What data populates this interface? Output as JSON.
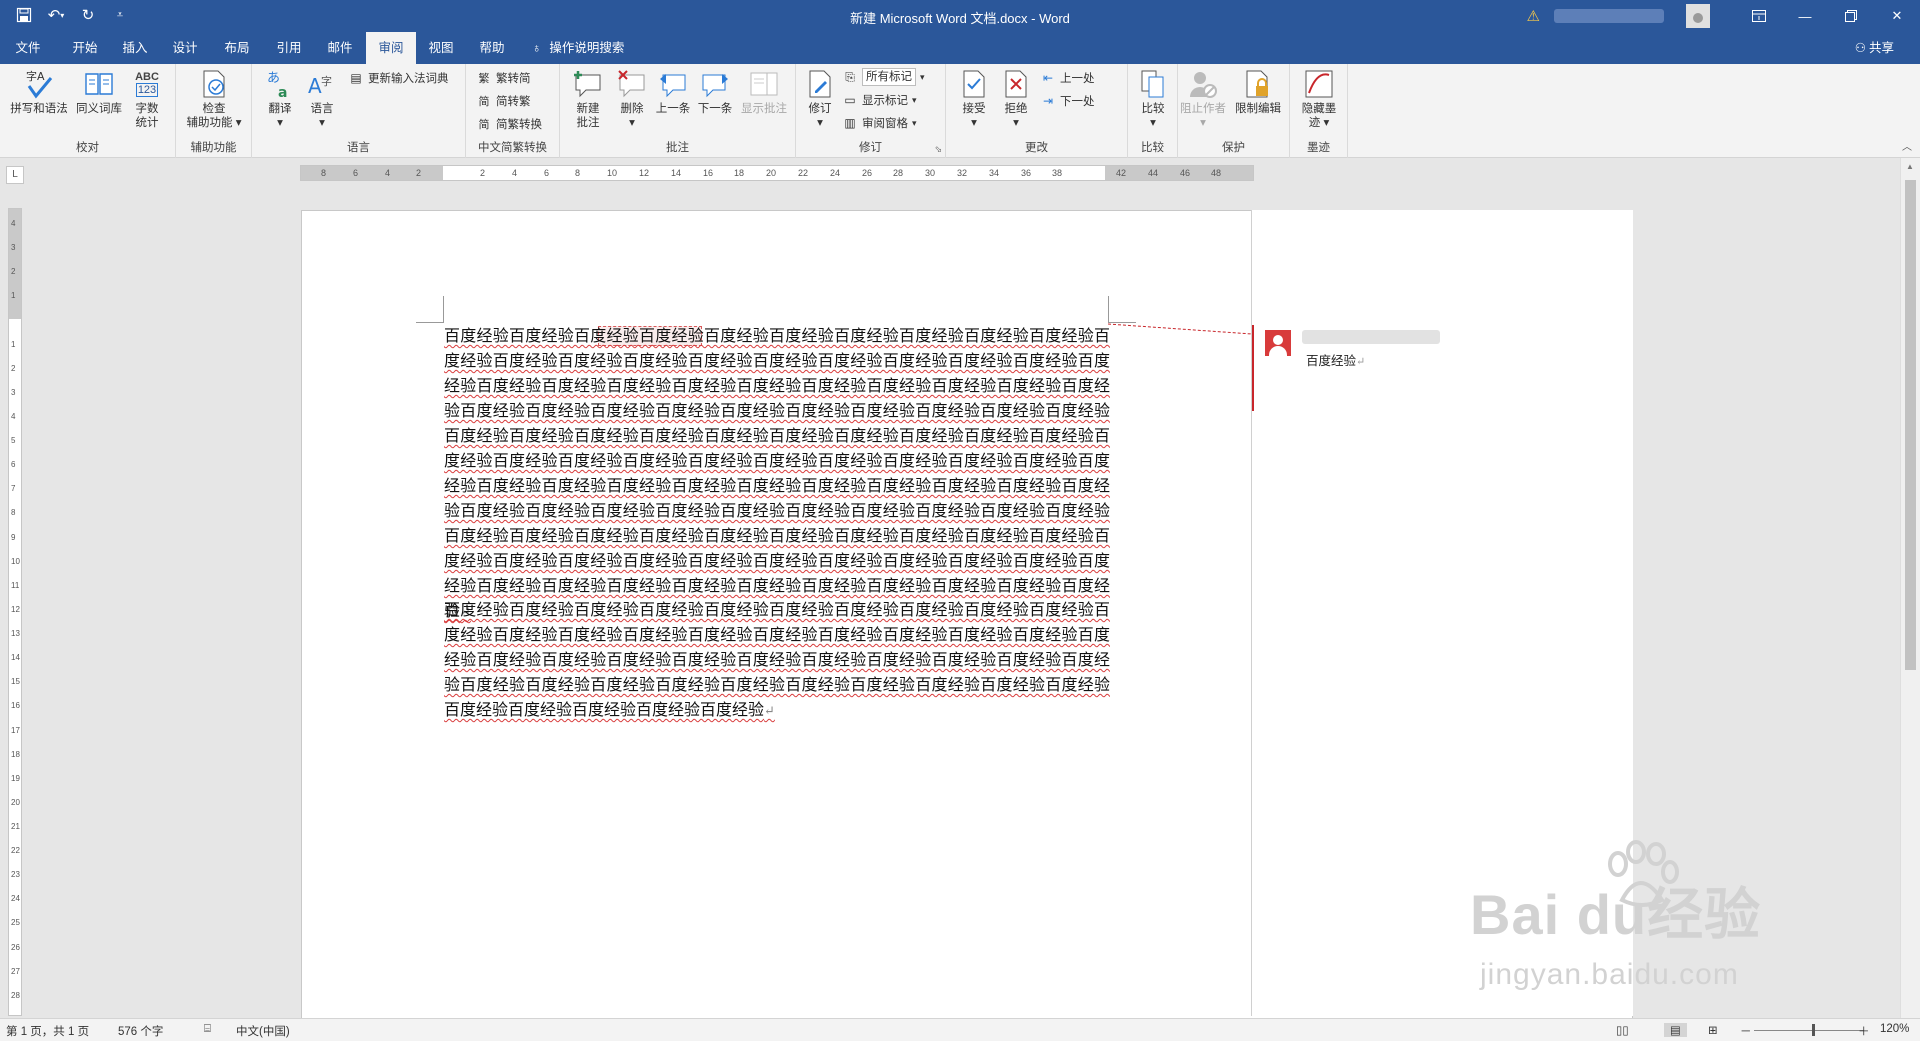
{
  "window": {
    "title": "新建 Microsoft Word 文档.docx  -  Word",
    "controls": [
      "restore-ribbon",
      "minimize",
      "maximize",
      "close"
    ]
  },
  "quick_access": {
    "icons": [
      "save-icon",
      "undo-icon",
      "redo-icon",
      "customize-icon"
    ]
  },
  "tabs": [
    {
      "label": "文件"
    },
    {
      "label": "开始"
    },
    {
      "label": "插入"
    },
    {
      "label": "设计"
    },
    {
      "label": "布局"
    },
    {
      "label": "引用"
    },
    {
      "label": "邮件"
    },
    {
      "label": "审阅",
      "active": true
    },
    {
      "label": "视图"
    },
    {
      "label": "帮助"
    }
  ],
  "tell_me": "操作说明搜索",
  "share": "共享",
  "ribbon": {
    "proofing": {
      "label": "校对",
      "spelling": "拼写和语法",
      "thesaurus": "同义词库",
      "wordcount_l1": "字数",
      "wordcount_l2": "统计",
      "wordcount_icon_text": "ABC",
      "wordcount_icon_num": "123",
      "spelling_icon_text": "字A"
    },
    "accessibility": {
      "label": "辅助功能",
      "check_l1": "检查",
      "check_l2": "辅助功能"
    },
    "language": {
      "label": "语言",
      "translate": "翻译",
      "language": "语言",
      "update_ime": "更新输入法词典"
    },
    "chinese_conversion": {
      "label": "中文简繁转换",
      "to_simplified": "繁转简",
      "to_traditional": "简转繁",
      "convert": "简繁转换"
    },
    "comments": {
      "label": "批注",
      "new_l1": "新建",
      "new_l2": "批注",
      "delete": "删除",
      "previous": "上一条",
      "next": "下一条",
      "show": "显示批注"
    },
    "tracking": {
      "label": "修订",
      "track": "修订",
      "markup_value": "所有标记",
      "show_markup": "显示标记",
      "reviewing_pane": "审阅窗格"
    },
    "changes": {
      "label": "更改",
      "accept": "接受",
      "reject": "拒绝",
      "previous": "上一处",
      "next": "下一处"
    },
    "compare": {
      "label": "比较",
      "compare": "比较"
    },
    "protect": {
      "label": "保护",
      "block_authors": "阻止作者",
      "restrict": "限制编辑"
    },
    "ink": {
      "label": "墨迹",
      "hide_l1": "隐藏墨",
      "hide_l2": "迹"
    }
  },
  "ruler": {
    "corner": "L",
    "h_numbers": [
      "8",
      "6",
      "4",
      "2",
      "",
      "2",
      "4",
      "6",
      "8",
      "10",
      "12",
      "14",
      "16",
      "18",
      "20",
      "22",
      "24",
      "26",
      "28",
      "30",
      "32",
      "34",
      "36",
      "38",
      "",
      "42",
      "44",
      "46",
      "48"
    ],
    "v_numbers": [
      "4",
      "3",
      "2",
      "1",
      "",
      "1",
      "2",
      "3",
      "4",
      "5",
      "6",
      "7",
      "8",
      "9",
      "10",
      "11",
      "12",
      "13",
      "14",
      "15",
      "16",
      "17",
      "18",
      "19",
      "20",
      "21",
      "22",
      "23",
      "24",
      "25",
      "26",
      "27",
      "28"
    ]
  },
  "document": {
    "paragraph1": "百度经验百度经验百度经验百度经验百度经验百度经验百度经验百度经验百度经验百度经验百度经验百度经验百度经验百度经验百度经验百度经验百度经验百度经验百度经验百度经验百度经验百度经验百度经验百度经验百度经验百度经验百度经验百度经验百度经验百度经验百度经验百度经验百度经验百度经验百度经验百度经验百度经验百度经验百度经验百度经验百度经验百度经验百度经验百度经验百度经验百度经验百度经验百度经验百度经验百度经验百度经验百度经验百度经验百度经验百度经验百度经验百度经验百度经验百度经验百度经验百度经验百度经验百度经验百度经验百度经验百度经验百度经验百度经验百度经验百度经验百度经验百度经验百度经验百度经验百度经验百度经验百度经验百度经验百度经验百度经验百度经验百度经验百度经验百度经验百度经验百度经验百度经验百度经验百度经验百度经验百度经验百度经验百度经验百度经验百度经验百度经验百度经验百度经验百度经验百度经验百度经验百度经验百度经验百度经验百度经验百度经验百度经验百度经验百度经验百度经验百度经验百度经验百度经验",
    "paragraph2": "百度经验百度经验百度经验百度经验百度经验百度经验百度经验百度经验百度经验百度经验百度经验百度经验百度经验百度经验百度经验百度经验百度经验百度经验百度经验百度经验百度经验百度经验百度经验百度经验百度经验百度经验百度经验百度经验百度经验百度经验百度经验百度经验百度经验百度经验百度经验百度经验百度经验百度经验百度经验百度经验百度经验百度经验百度经验百度经验百度经验百度经验",
    "para_mark": "↵"
  },
  "comment": {
    "text": "百度经验",
    "color": "#c8262b"
  },
  "watermark": {
    "brand": "Bai  du经验",
    "url": "jingyan.baidu.com"
  },
  "status": {
    "page": "第 1 页，共 1 页",
    "words": "576 个字",
    "language": "中文(中国)",
    "zoom": "120%",
    "zoom_level_percent": 120
  },
  "colors": {
    "accent": "#2b579a",
    "spell_error": "#d83b3b"
  }
}
